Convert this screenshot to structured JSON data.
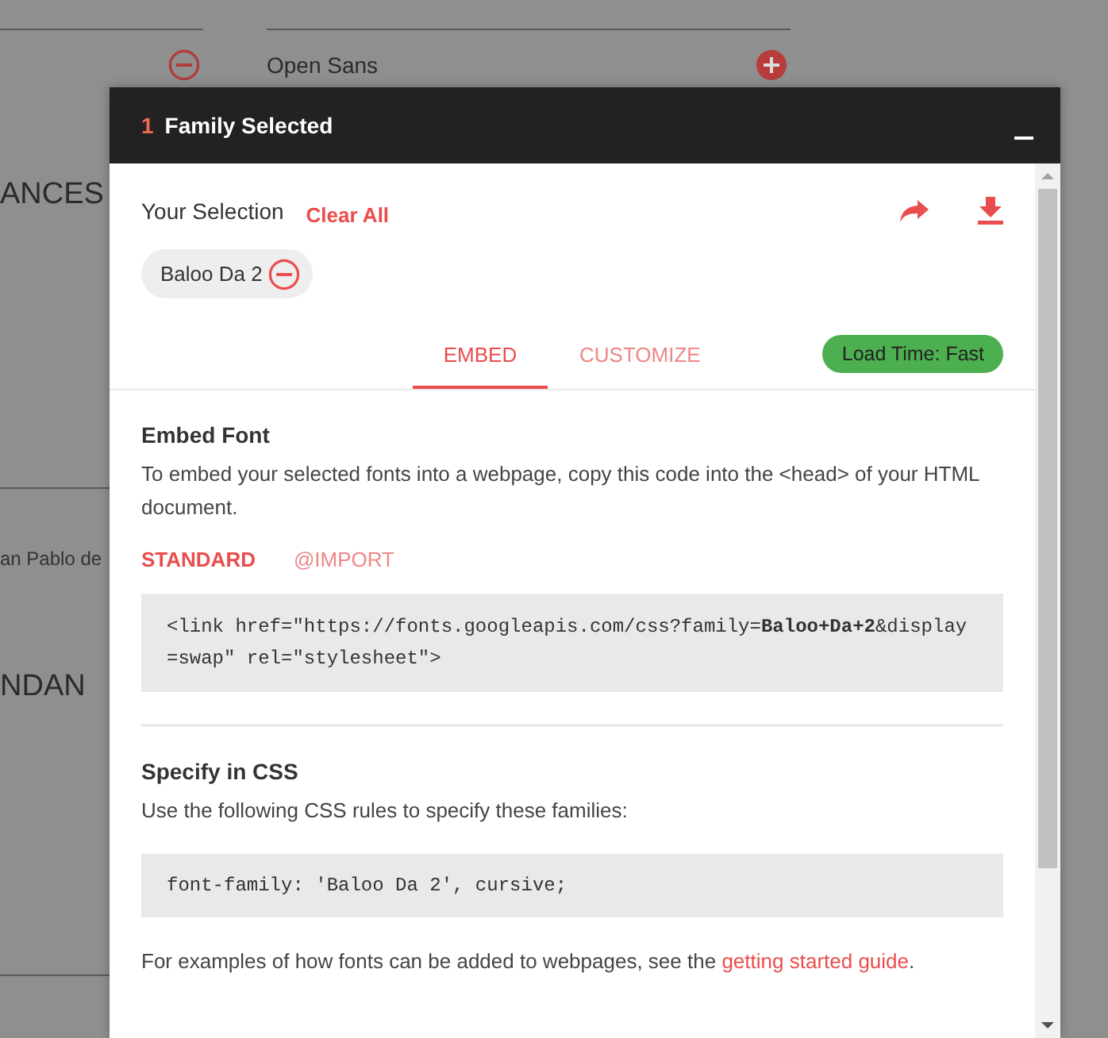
{
  "background": {
    "fonts": [
      {
        "added": true
      },
      {
        "name": "Open Sans",
        "added": false
      }
    ],
    "headings": [
      "ANCES",
      "NDAN"
    ],
    "credit": "an Pablo de"
  },
  "panel": {
    "count": "1",
    "title": "Family Selected",
    "selection_label": "Your Selection",
    "clear_all": "Clear All",
    "chips": [
      {
        "name": "Baloo Da 2"
      }
    ],
    "tabs": [
      {
        "label": "EMBED",
        "selected": true
      },
      {
        "label": "CUSTOMIZE",
        "selected": false
      }
    ],
    "load_time": "Load Time: Fast",
    "embed": {
      "title": "Embed Font",
      "description": "To embed your selected fonts into a webpage, copy this code into the <head> of your HTML document.",
      "methods": [
        {
          "label": "STANDARD",
          "selected": true
        },
        {
          "label": "@IMPORT",
          "selected": false
        }
      ],
      "code": "<link href=\"https://fonts.googleapis.com/css?family=**Baloo+Da+2**&display=swap\" rel=\"stylesheet\">"
    },
    "css": {
      "title": "Specify in CSS",
      "description": "Use the following CSS rules to specify these families:",
      "code": "font-family: 'Baloo Da 2', cursive;",
      "note": "For examples of how fonts can be added to webpages, see the",
      "link": "getting started guide",
      "note_end": "."
    }
  }
}
